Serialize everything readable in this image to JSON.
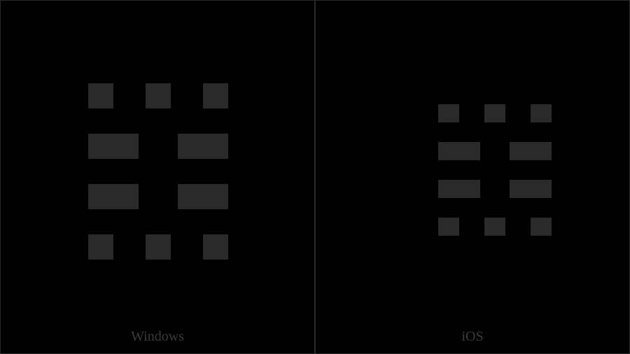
{
  "panels": [
    {
      "label": "Windows",
      "variant": "windows"
    },
    {
      "label": "iOS",
      "variant": "ios"
    }
  ],
  "glyph": {
    "description": "Tetragram glyph (Tai Xuan Jing style), four rows: row1 three small segments, row2 two large segments, row3 two large segments, row4 three small segments",
    "codepoint_hint": "U+1D33A range (Tai Xuan Jing Symbols)",
    "rows": [
      {
        "type": "three-small"
      },
      {
        "type": "two-large"
      },
      {
        "type": "two-large"
      },
      {
        "type": "three-small"
      }
    ]
  },
  "colors": {
    "background": "#000000",
    "segment": "#2a2a2a",
    "border": "#2a2a2a",
    "caption": "#3a3a3a"
  }
}
